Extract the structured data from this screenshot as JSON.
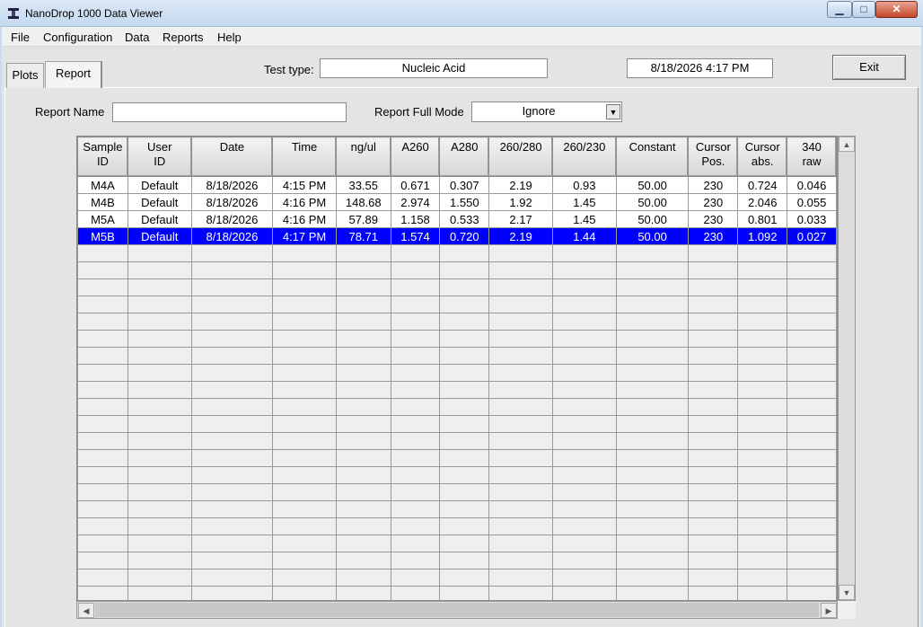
{
  "window": {
    "title": "NanoDrop 1000 Data Viewer",
    "min_glyph": "▁",
    "max_glyph": "□",
    "close_glyph": "✕"
  },
  "menu": [
    "File",
    "Configuration",
    "Data",
    "Reports",
    "Help"
  ],
  "tabs": [
    "Plots",
    "Report"
  ],
  "active_tab": "Report",
  "header": {
    "test_type_label": "Test type:",
    "test_type_value": "Nucleic Acid",
    "datetime": "8/18/2026  4:17 PM",
    "exit_label": "Exit"
  },
  "report": {
    "name_label": "Report Name",
    "name_value": "",
    "full_mode_label": "Report Full Mode",
    "full_mode_value": "Ignore"
  },
  "table": {
    "columns": [
      "Sample\nID",
      "User\nID",
      "Date",
      "Time",
      "ng/ul",
      "A260",
      "A280",
      "260/280",
      "260/230",
      "Constant",
      "Cursor\nPos.",
      "Cursor\nabs.",
      "340\nraw"
    ],
    "rows": [
      [
        "M4A",
        "Default",
        "8/18/2026",
        "4:15 PM",
        "33.55",
        "0.671",
        "0.307",
        "2.19",
        "0.93",
        "50.00",
        "230",
        "0.724",
        "0.046"
      ],
      [
        "M4B",
        "Default",
        "8/18/2026",
        "4:16 PM",
        "148.68",
        "2.974",
        "1.550",
        "1.92",
        "1.45",
        "50.00",
        "230",
        "2.046",
        "0.055"
      ],
      [
        "M5A",
        "Default",
        "8/18/2026",
        "4:16 PM",
        "57.89",
        "1.158",
        "0.533",
        "2.17",
        "1.45",
        "50.00",
        "230",
        "0.801",
        "0.033"
      ],
      [
        "M5B",
        "Default",
        "8/18/2026",
        "4:17 PM",
        "78.71",
        "1.574",
        "0.720",
        "2.19",
        "1.44",
        "50.00",
        "230",
        "1.092",
        "0.027"
      ]
    ],
    "selected_row": 3,
    "empty_row_count": 21
  },
  "colors": {
    "selection": "#0000ff",
    "window_bg": "#e4e4e4"
  }
}
